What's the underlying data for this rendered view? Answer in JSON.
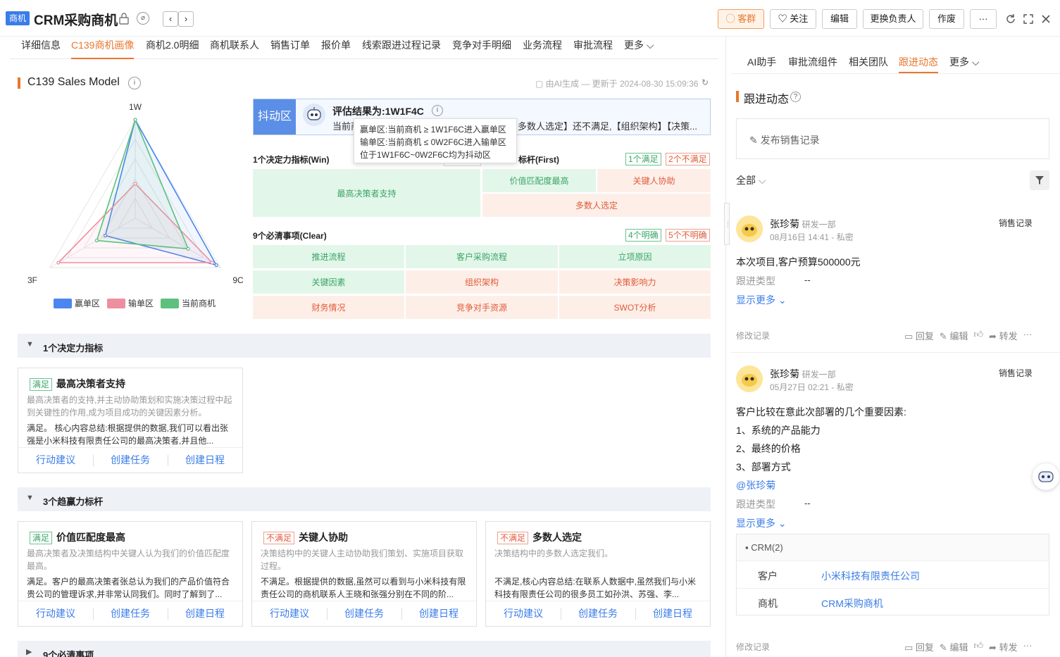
{
  "header": {
    "badge": "商机",
    "title": "CRM采购商机",
    "buttons": {
      "group": "客群",
      "follow": "关注",
      "edit": "编辑",
      "change_owner": "更换负责人",
      "void": "作废",
      "more": "···"
    }
  },
  "tabs": [
    "详细信息",
    "C139商机画像",
    "商机2.0明细",
    "商机联系人",
    "销售订单",
    "报价单",
    "线索跟进过程记录",
    "竞争对手明细",
    "业务流程",
    "审批流程",
    "更多"
  ],
  "model": {
    "title": "C139 Sales Model",
    "ai_note": "由AI生成 — 更新于 2024-08-30 15:09:36"
  },
  "chart_data": {
    "type": "radar",
    "axes": [
      "1W",
      "3F",
      "9C"
    ],
    "range": [
      0,
      1
    ],
    "legend": [
      "赢单区",
      "输单区",
      "当前商机"
    ],
    "series": [
      {
        "name": "赢单区",
        "color": "#4a86ee",
        "values": [
          1,
          0.35,
          0.95
        ]
      },
      {
        "name": "输单区",
        "color": "#ee8fa0",
        "values": [
          0.35,
          0.9,
          0.9
        ]
      },
      {
        "name": "当前商机",
        "color": "#5ec07e",
        "values": [
          1,
          0.45,
          0.62
        ]
      }
    ]
  },
  "eval": {
    "zone": "抖动区",
    "result": "评估结果为:1W1F4C",
    "desc_left": "当前商",
    "desc_right": "多数人选定】还不满足,【组织架构】【决策..."
  },
  "tooltip": [
    "赢单区:当前商机 ≥ 1W1F6C进入赢单区",
    "输单区:当前商机 ≤ 0W2F6C进入输单区",
    "位于1W1F6C~0W2F6C均为抖动区"
  ],
  "win": {
    "label": "1个决定力指标(Win)",
    "cell": "最高决策者支持"
  },
  "first": {
    "label": "标杆(First)",
    "tag_ok": "1个满足",
    "tag_no": "2个不满足",
    "cells": [
      "价值匹配度最高",
      "关键人协助",
      "多数人选定"
    ]
  },
  "clear": {
    "label": "9个必清事项(Clear)",
    "tag_ok": "4个明确",
    "tag_no": "5个不明确",
    "cells": [
      "推进流程",
      "客户采购流程",
      "立项原因",
      "关键因素",
      "组织架构",
      "决策影响力",
      "财务情况",
      "竞争对手资源",
      "SWOT分析"
    ]
  },
  "section1": {
    "title": "1个决定力指标",
    "card": {
      "tag": "满足",
      "title": "最高决策者支持",
      "desc": "最高决策者的支持,并主动协助策划和实施决策过程中起到关键性的作用,成为项目成功的关键因素分析。",
      "body": "满足。 核心内容总结:根据提供的数据,我们可以看出张强是小米科技有限责任公司的最高决策者,并且他..."
    }
  },
  "section2": {
    "title": "3个趋赢力标杆",
    "cards": [
      {
        "tag": "满足",
        "title": "价值匹配度最高",
        "desc": "最高决策者及决策结构中关键人认为我们的价值匹配度最高。",
        "body": "满足。客户的最高决策者张总认为我们的产品价值符合贵公司的管理诉求,并非常认同我们。同时了解到了..."
      },
      {
        "tag": "不满足",
        "title": "关键人协助",
        "desc": "决策结构中的关键人主动协助我们策划、实施项目获取过程。",
        "body": "不满足。根据提供的数据,虽然可以看到与小米科技有限责任公司的商机联系人王晓和张强分别在不同的阶..."
      },
      {
        "tag": "不满足",
        "title": "多数人选定",
        "desc": "决策结构中的多数人选定我们。",
        "body": "不满足,核心内容总结:在联系人数据中,虽然我们与小米科技有限责任公司的很多员工如孙洪、苏强、李..."
      }
    ]
  },
  "section3": {
    "title": "9个必清事项"
  },
  "card_actions": [
    "行动建议",
    "创建任务",
    "创建日程"
  ],
  "right": {
    "tabs": [
      "AI助手",
      "审批流组件",
      "相关团队",
      "跟进动态",
      "更多"
    ],
    "title": "跟进动态",
    "post": "发布销售记录",
    "filter": "全部",
    "feed": [
      {
        "name": "张珍菊",
        "dept": "研发一部",
        "time": "08月16日 14:41 - 私密",
        "type": "销售记录",
        "lines": [
          "本次项目,客户预算500000元"
        ],
        "field": "跟进类型",
        "field_val": "--",
        "more": "显示更多"
      },
      {
        "name": "张珍菊",
        "dept": "研发一部",
        "time": "05月27日 02:21 - 私密",
        "type": "销售记录",
        "lines": [
          "客户比较在意此次部署的几个重要因素:",
          "1、系统的产品能力",
          "2、最终的价格",
          "3、部署方式"
        ],
        "mention": "@张珍菊",
        "field": "跟进类型",
        "field_val": "--",
        "more": "显示更多"
      }
    ],
    "crm": {
      "title": "CRM(2)",
      "rows": [
        {
          "k": "客户",
          "v": "小米科技有限责任公司"
        },
        {
          "k": "商机",
          "v": "CRM采购商机"
        }
      ]
    },
    "footer": {
      "log": "修改记录",
      "reply": "回复",
      "edit": "编辑",
      "forward": "转发",
      "more": "···"
    }
  }
}
